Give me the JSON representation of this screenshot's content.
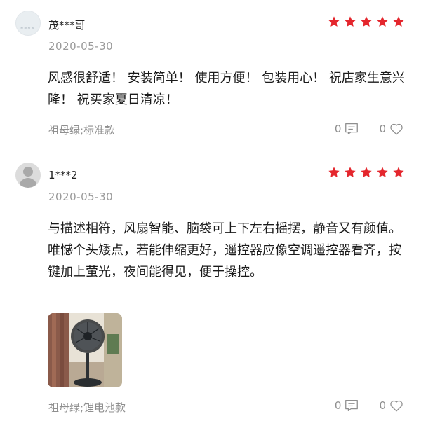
{
  "colors": {
    "star": "#e4262d",
    "muted": "#9a9a9a",
    "text": "#1a1a1a"
  },
  "reviews": [
    {
      "username": "茂***哥",
      "rating": 5,
      "date": "2020-05-30",
      "content": "风感很舒适！ 安装简单！ 使用方便！ 包装用心！ 祝店家生意兴隆！ 祝买家夏日清凉！",
      "variant": "祖母绿;标准款",
      "comment_count": "0",
      "like_count": "0",
      "icons": [
        "comment-icon",
        "heart-icon",
        "star-icon"
      ]
    },
    {
      "username": "1***2",
      "rating": 5,
      "date": "2020-05-30",
      "content": "与描述相符，风扇智能、脑袋可上下左右摇摆，静音又有颜值。唯憾个头矮点，若能伸缩更好，遥控器应像空调遥控器看齐，按键加上萤光，夜间能得见，便于操控。",
      "variant": "祖母绿;锂电池款",
      "comment_count": "0",
      "like_count": "0",
      "icons": [
        "comment-icon",
        "heart-icon",
        "star-icon"
      ]
    }
  ]
}
